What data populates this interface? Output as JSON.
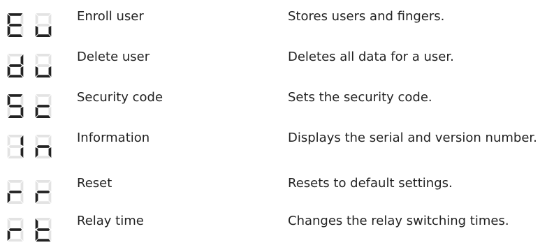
{
  "colors": {
    "segment_on": "#222222",
    "segment_off": "#e3e3e3",
    "text": "#222222"
  },
  "menu": {
    "items": [
      {
        "code": [
          "E",
          "u"
        ],
        "label": "Enroll user",
        "description": "Stores users and fingers."
      },
      {
        "code": [
          "d",
          "u"
        ],
        "label": "Delete user",
        "description": "Deletes all data for a user."
      },
      {
        "code": [
          "S",
          "c"
        ],
        "label": "Security code",
        "description": "Sets the security code."
      },
      {
        "code": [
          "I",
          "n"
        ],
        "label": "Information",
        "description": "Displays the serial and version number."
      },
      {
        "code": [
          "r",
          "r"
        ],
        "label": "Reset",
        "description": "Resets to default settings."
      },
      {
        "code": [
          "r",
          "t"
        ],
        "label": "Relay time",
        "description": "Changes the relay switching times."
      }
    ]
  }
}
